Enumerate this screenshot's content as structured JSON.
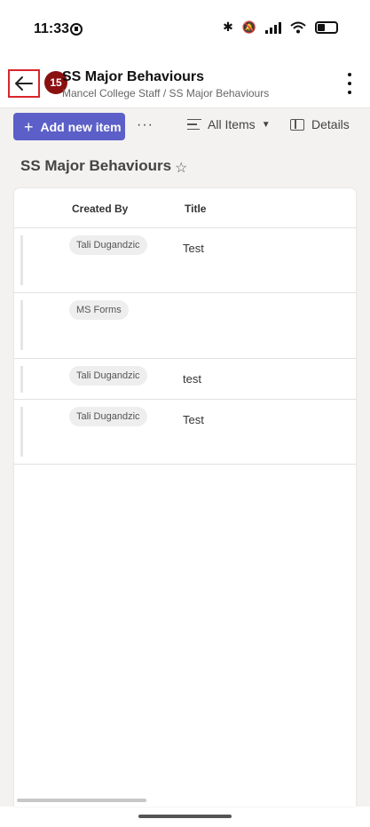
{
  "status_bar": {
    "time": "11:33",
    "icons": [
      "circle-icon",
      "bluetooth-icon",
      "mute-icon",
      "signal-icon",
      "wifi-icon",
      "battery-icon"
    ]
  },
  "header": {
    "back_icon": "arrow-left-icon",
    "badge": "15",
    "title": "SS Major Behaviours",
    "subtitle": "Mancel College Staff / SS Major Behaviours",
    "more_icon": "more-vertical-icon"
  },
  "toolbar": {
    "add_label": "Add new item",
    "ellipsis": "···",
    "view_label": "All Items",
    "details_label": "Details"
  },
  "list": {
    "title": "SS Major Behaviours",
    "columns": [
      "Created By",
      "Title"
    ],
    "rows": [
      {
        "created_by": "Tali Dugandzic",
        "title": "Test"
      },
      {
        "created_by": "MS Forms",
        "title": ""
      },
      {
        "created_by": "Tali Dugandzic",
        "title": "test"
      },
      {
        "created_by": "Tali Dugandzic",
        "title": "Test"
      }
    ]
  },
  "colors": {
    "accent": "#5b5fc7",
    "badge": "#8b1010",
    "highlight_border": "#d9262c",
    "background": "#f3f2f1"
  }
}
